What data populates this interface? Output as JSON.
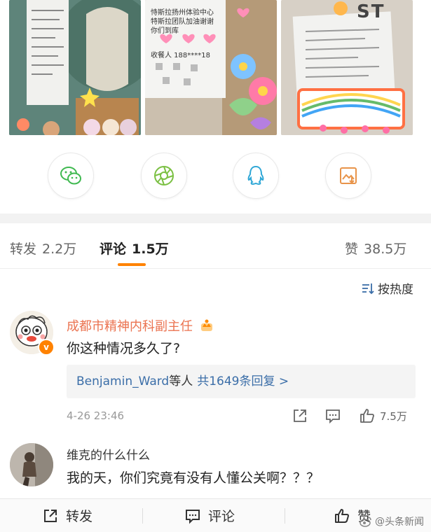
{
  "photos": {
    "receipt_lines": "恃斯拉扬州体验中心特斯拉团队加油谢谢你们到库",
    "phone": "收餐人 188****18",
    "brand_fragment": "ST"
  },
  "share": {
    "icons": [
      "wechat-icon",
      "moments-icon",
      "qq-icon",
      "save-image-icon"
    ]
  },
  "tabs": {
    "repost_label": "转发",
    "repost_count": "2.2万",
    "comment_label": "评论",
    "comment_count": "1.5万",
    "like_label": "赞",
    "like_count": "38.5万"
  },
  "sort": {
    "label": "按热度"
  },
  "comments": [
    {
      "user": "成都市精神内科副主任",
      "text": "你这种情况多久了?",
      "reply_user": "Benjamin_Ward",
      "reply_mid": "等人",
      "reply_count": "共1649条回复 >",
      "time": "4-26 23:46",
      "likes": "7.5万"
    },
    {
      "user": "维克的什么什么",
      "text": "我的天，你们究竟有没有人懂公关啊？？？"
    }
  ],
  "bottom_bar": {
    "repost": "转发",
    "comment": "评论",
    "like": "赞"
  },
  "watermark": "头条新闻",
  "colors": {
    "accent": "#ff8200",
    "username": "#eb7350",
    "link": "#3b6ea8"
  }
}
